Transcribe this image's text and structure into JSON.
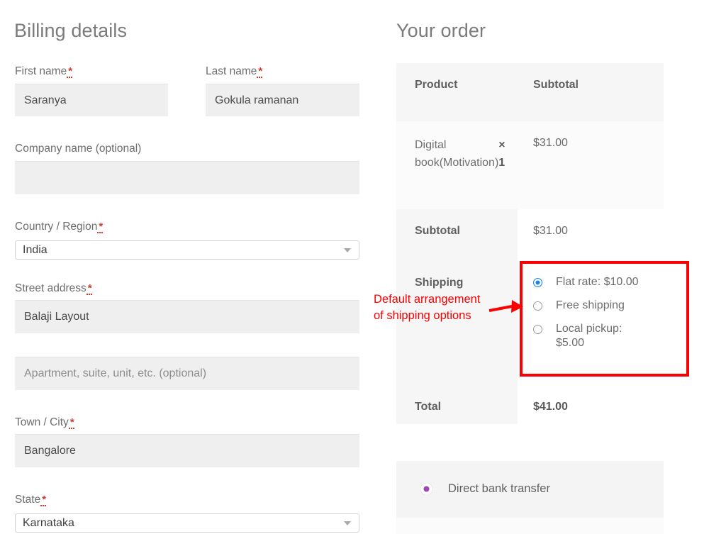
{
  "billing": {
    "heading": "Billing details",
    "fields": {
      "first_name": {
        "label": "First name",
        "value": "Saranya",
        "required_mark": "*"
      },
      "last_name": {
        "label": "Last name",
        "value": "Gokula ramanan",
        "required_mark": "*"
      },
      "company": {
        "label": "Company name (optional)",
        "value": ""
      },
      "country": {
        "label": "Country / Region",
        "value": "India",
        "required_mark": "*"
      },
      "street": {
        "label": "Street address",
        "value": "Balaji Layout",
        "required_mark": "*"
      },
      "apartment": {
        "placeholder": "Apartment, suite, unit, etc. (optional)",
        "value": ""
      },
      "city": {
        "label": "Town / City",
        "value": "Bangalore",
        "required_mark": "*"
      },
      "state": {
        "label": "State",
        "value": "Karnataka",
        "required_mark": "*"
      }
    }
  },
  "order": {
    "heading": "Your order",
    "columns": {
      "product": "Product",
      "subtotal": "Subtotal"
    },
    "line_items": [
      {
        "name": "Digital book(Motivation)",
        "qty": "× 1",
        "subtotal": "$31.00"
      }
    ],
    "subtotal_label": "Subtotal",
    "subtotal_value": "$31.00",
    "shipping_label": "Shipping",
    "shipping_options": [
      {
        "label": "Flat rate: $10.00",
        "selected": true
      },
      {
        "label": "Free shipping",
        "selected": false
      },
      {
        "label": "Local pickup: $5.00",
        "selected": false
      }
    ],
    "total_label": "Total",
    "total_value": "$41.00"
  },
  "payment": {
    "methods": [
      {
        "label": "Direct bank transfer",
        "selected": true
      }
    ]
  },
  "annotation": {
    "line1": "Default arrangement",
    "line2": "of shipping options",
    "color": "#fb0000"
  }
}
